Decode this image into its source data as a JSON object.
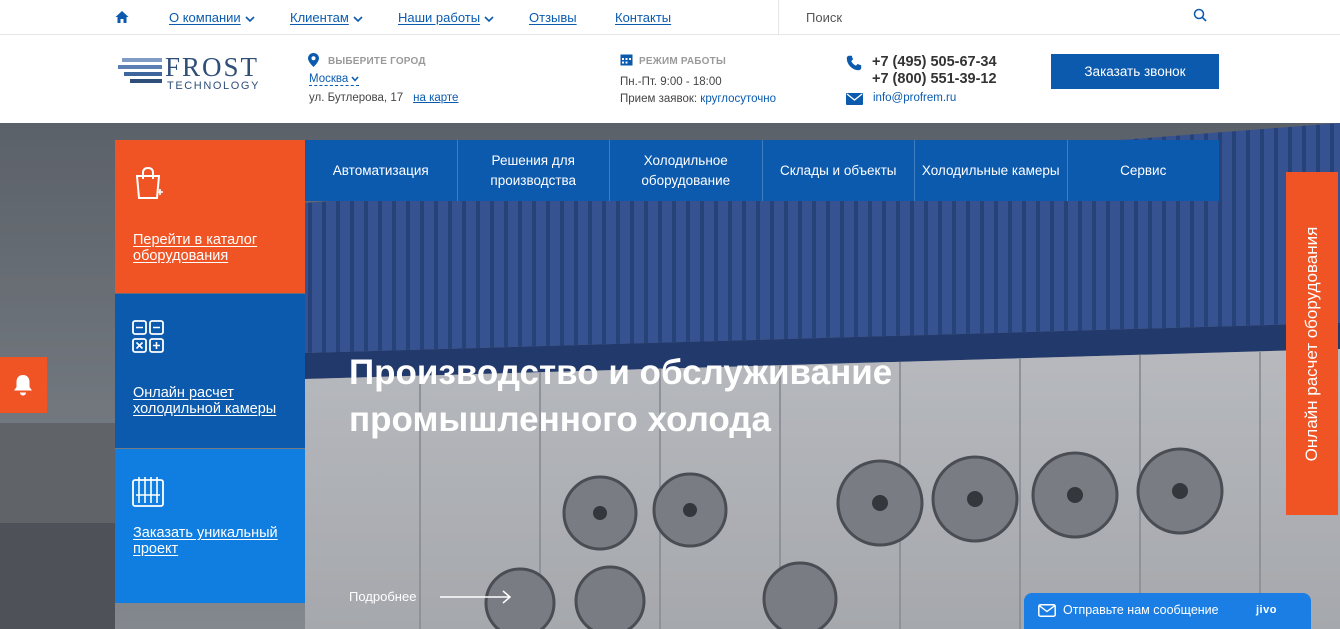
{
  "topnav": {
    "items": [
      {
        "label": "О компании",
        "has_dropdown": true
      },
      {
        "label": "Клиентам",
        "has_dropdown": true
      },
      {
        "label": "Наши работы",
        "has_dropdown": true
      },
      {
        "label": "Отзывы",
        "has_dropdown": false
      },
      {
        "label": "Контакты",
        "has_dropdown": false
      }
    ],
    "search_placeholder": "Поиск"
  },
  "header": {
    "logo": {
      "main": "FROST",
      "sub": "TECHNOLOGY"
    },
    "city": {
      "label": "Выберите город",
      "value": "Москва",
      "address": "ул. Бутлерова, 17",
      "map_link": "на карте"
    },
    "hours": {
      "label": "Режим работы",
      "line1": "Пн.-Пт. 9:00 - 18:00",
      "line2_prefix": "Прием заявок: ",
      "line2_accent": "круглосуточно"
    },
    "contacts": {
      "phone1": "+7 (495) 505-67-34",
      "phone2": "+7 (800) 551-39-12",
      "email": "info@profrem.ru"
    },
    "callback_button": "Заказать звонок"
  },
  "category_menu": [
    "Автоматизация",
    "Решения для производства",
    "Холодильное оборудование",
    "Склады и объекты",
    "Холодильные камеры",
    "Сервис"
  ],
  "side_tiles": [
    {
      "label": "Перейти в каталог оборудования",
      "icon": "shopping-bag-icon"
    },
    {
      "label": "Онлайн расчет холодильной камеры",
      "icon": "calculator-icon"
    },
    {
      "label": "Заказать уникальный проект",
      "icon": "blueprint-icon"
    }
  ],
  "hero": {
    "title": "Производство и обслуживание промышленного холода",
    "more_link": "Подробнее"
  },
  "online_calc_tab": "Онлайн расчет оборудования",
  "jivo": {
    "message": "Отправьте нам сообщение",
    "brand": "jivo"
  },
  "colors": {
    "primary_blue": "#0b5aae",
    "light_blue": "#0f7ee0",
    "orange": "#f05424",
    "link_blue": "#0a5bb0"
  }
}
